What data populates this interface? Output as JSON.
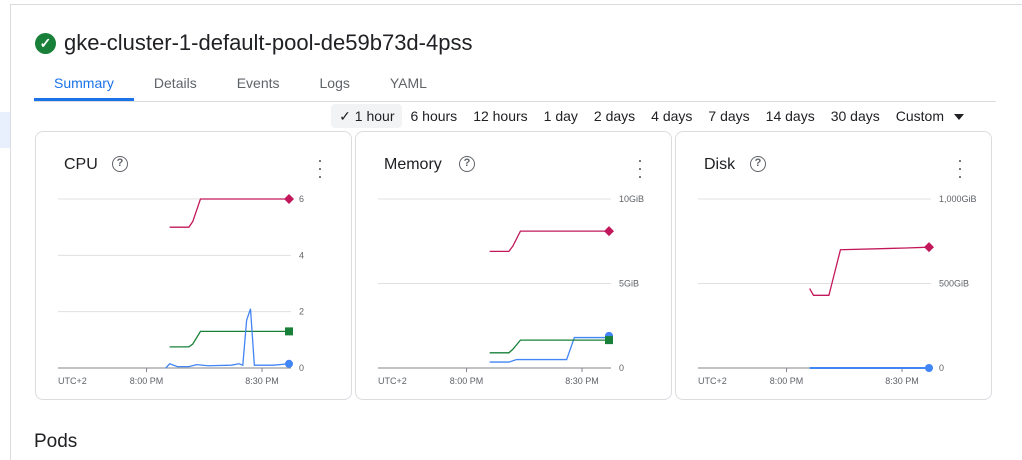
{
  "header": {
    "title": "gke-cluster-1-default-pool-de59b73d-4pss",
    "status_icon": "check-circle-icon",
    "status_color": "#188038"
  },
  "tabs": [
    {
      "label": "Summary",
      "active": true
    },
    {
      "label": "Details"
    },
    {
      "label": "Events"
    },
    {
      "label": "Logs"
    },
    {
      "label": "YAML"
    }
  ],
  "time_ranges": {
    "selected": "1 hour",
    "items": [
      "1 hour",
      "6 hours",
      "12 hours",
      "1 day",
      "2 days",
      "4 days",
      "7 days",
      "14 days",
      "30 days",
      "Custom"
    ]
  },
  "colors": {
    "red": "#c2185b",
    "green": "#188038",
    "blue": "#4285f4"
  },
  "chart_data": [
    {
      "type": "line",
      "title": "CPU",
      "xlim": [
        "19:37",
        "20:37"
      ],
      "ylim": [
        0,
        6
      ],
      "yticks": [
        "0",
        "2",
        "4",
        "6"
      ],
      "xticks": [
        "UTC+2",
        "8:00 PM",
        "8:30 PM"
      ],
      "series": [
        {
          "color": "red",
          "marker": "diamond",
          "x": [
            "20:06",
            "20:11",
            "20:12",
            "20:14",
            "20:37"
          ],
          "y": [
            5,
            5,
            5.2,
            6,
            6
          ]
        },
        {
          "color": "green",
          "marker": "square",
          "x": [
            "20:06",
            "20:11",
            "20:12",
            "20:14",
            "20:37"
          ],
          "y": [
            0.75,
            0.75,
            0.85,
            1.3,
            1.3
          ]
        },
        {
          "color": "blue",
          "marker": "circle",
          "x": [
            "20:05",
            "20:06",
            "20:08",
            "20:11",
            "20:13",
            "20:16",
            "20:22",
            "20:24",
            "20:25",
            "20:26",
            "20:27",
            "20:28",
            "20:33",
            "20:37"
          ],
          "y": [
            0,
            0.15,
            0.05,
            0.05,
            0.12,
            0.08,
            0.1,
            0.15,
            0.1,
            1.7,
            2.1,
            0.1,
            0.1,
            0.15
          ]
        }
      ]
    },
    {
      "type": "line",
      "title": "Memory",
      "xlim": [
        "19:37",
        "20:37"
      ],
      "ylim": [
        0,
        10
      ],
      "yticks": [
        "0",
        "5GiB",
        "10GiB"
      ],
      "xticks": [
        "UTC+2",
        "8:00 PM",
        "8:30 PM"
      ],
      "series": [
        {
          "color": "red",
          "marker": "diamond",
          "x": [
            "20:06",
            "20:11",
            "20:12",
            "20:14",
            "20:37"
          ],
          "y": [
            6.9,
            6.9,
            7.2,
            8.1,
            8.1
          ]
        },
        {
          "color": "blue",
          "marker": "circle",
          "x": [
            "20:06",
            "20:11",
            "20:13",
            "20:26",
            "20:28",
            "20:36",
            "20:37"
          ],
          "y": [
            0.35,
            0.35,
            0.5,
            0.5,
            1.8,
            1.8,
            1.9
          ]
        },
        {
          "color": "green",
          "marker": "square",
          "x": [
            "20:06",
            "20:11",
            "20:12",
            "20:14",
            "20:37"
          ],
          "y": [
            0.9,
            0.9,
            1.1,
            1.65,
            1.65
          ]
        }
      ]
    },
    {
      "type": "line",
      "title": "Disk",
      "xlim": [
        "19:37",
        "20:37"
      ],
      "ylim": [
        0,
        1000
      ],
      "yticks": [
        "0",
        "500GiB",
        "1,000GiB"
      ],
      "xticks": [
        "UTC+2",
        "8:00 PM",
        "8:30 PM"
      ],
      "series": [
        {
          "color": "red",
          "marker": "diamond",
          "x": [
            "20:06",
            "20:07",
            "20:11",
            "20:12",
            "20:14",
            "20:31",
            "20:37"
          ],
          "y": [
            470,
            430,
            430,
            520,
            700,
            710,
            715
          ]
        },
        {
          "color": "blue",
          "marker": "circle",
          "x": [
            "20:06",
            "20:37"
          ],
          "y": [
            0,
            0
          ]
        }
      ]
    }
  ],
  "sections": {
    "pods": "Pods"
  }
}
